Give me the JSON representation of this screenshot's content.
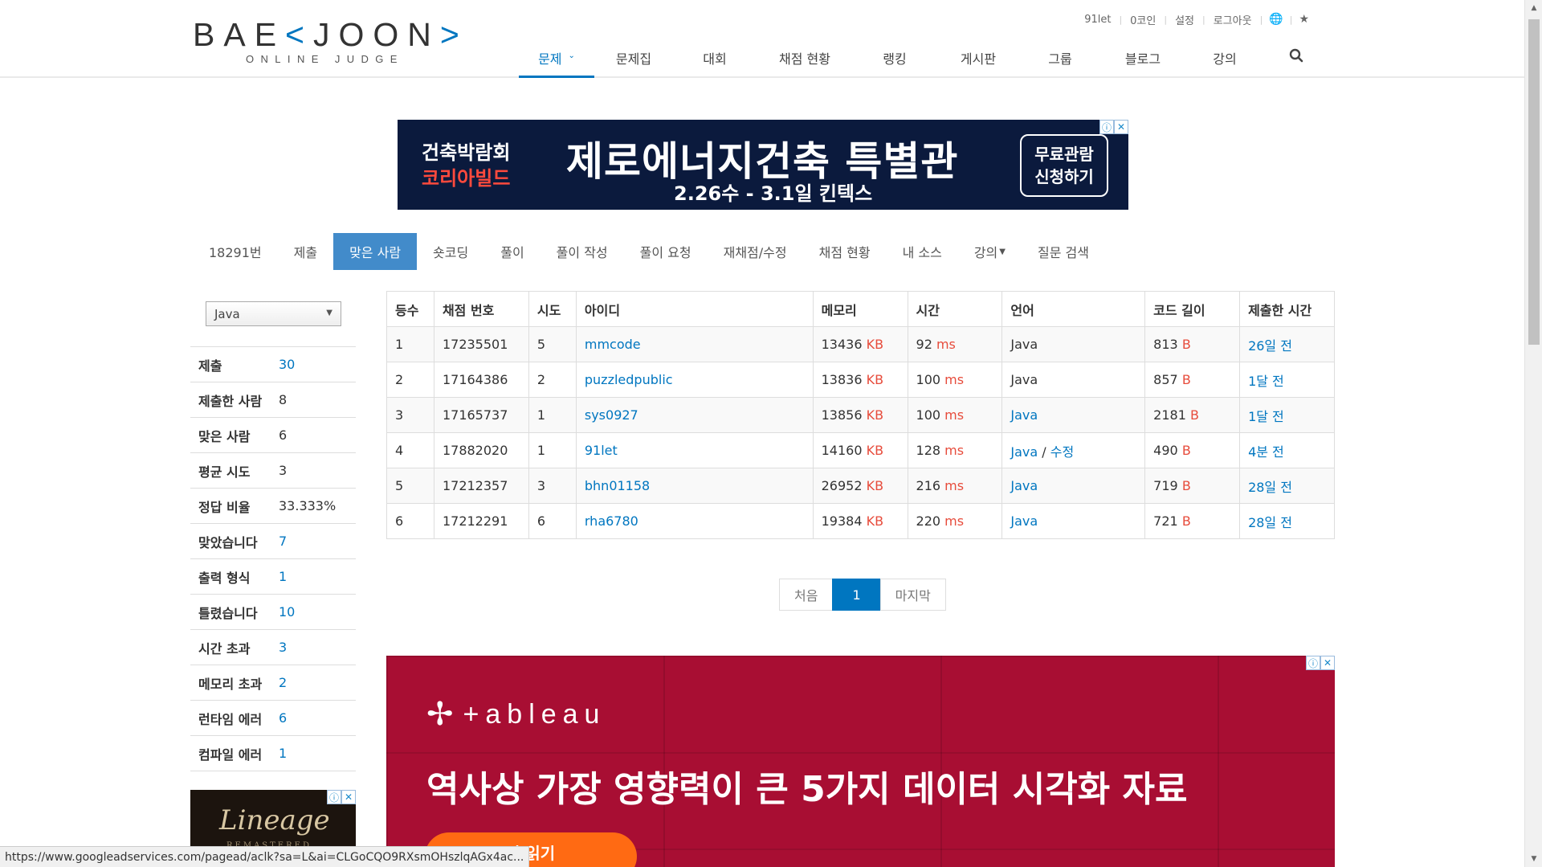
{
  "header": {
    "logo": {
      "main_prefix": "BAE",
      "main_accent": "<",
      "main_mid": "JOON",
      "main_accent2": ">",
      "sub": "ONLINE JUDGE"
    },
    "topbar": {
      "user": "91let",
      "coins": "0코인",
      "settings": "설정",
      "logout": "로그아웃",
      "globe_icon": "globe-icon",
      "star_icon": "star-icon"
    },
    "nav": [
      {
        "label": "문제",
        "active": true,
        "dropdown": true
      },
      {
        "label": "문제집"
      },
      {
        "label": "대회"
      },
      {
        "label": "채점 현황"
      },
      {
        "label": "랭킹"
      },
      {
        "label": "게시판"
      },
      {
        "label": "그룹"
      },
      {
        "label": "블로그"
      },
      {
        "label": "강의"
      }
    ],
    "search_icon": "search-icon"
  },
  "ad_top": {
    "left_line1": "건축박람회",
    "left_line2": "코리아빌드",
    "title": "제로에너지건축 특별관",
    "date": "2.26수 - 3.1일 킨텍스",
    "button_line1": "무료관람",
    "button_line2": "신청하기"
  },
  "subnav": [
    {
      "label": "18291번"
    },
    {
      "label": "제출"
    },
    {
      "label": "맞은 사람",
      "active": true
    },
    {
      "label": "숏코딩"
    },
    {
      "label": "풀이"
    },
    {
      "label": "풀이 작성"
    },
    {
      "label": "풀이 요청"
    },
    {
      "label": "재채점/수정"
    },
    {
      "label": "채점 현황"
    },
    {
      "label": "내 소스"
    },
    {
      "label": "강의",
      "dropdown": true
    },
    {
      "label": "질문 검색"
    }
  ],
  "language_filter": {
    "selected": "Java"
  },
  "stats": [
    {
      "label": "제출",
      "value": "30",
      "link": true
    },
    {
      "label": "제출한 사람",
      "value": "8",
      "link": false
    },
    {
      "label": "맞은 사람",
      "value": "6",
      "link": false
    },
    {
      "label": "평균 시도",
      "value": "3",
      "link": false
    },
    {
      "label": "정답 비율",
      "value": "33.333%",
      "link": false
    },
    {
      "label": "맞았습니다",
      "value": "7",
      "link": true
    },
    {
      "label": "출력 형식",
      "value": "1",
      "link": true
    },
    {
      "label": "틀렸습니다",
      "value": "10",
      "link": true
    },
    {
      "label": "시간 초과",
      "value": "3",
      "link": true
    },
    {
      "label": "메모리 초과",
      "value": "2",
      "link": true
    },
    {
      "label": "런타임 에러",
      "value": "6",
      "link": true
    },
    {
      "label": "컴파일 에러",
      "value": "1",
      "link": true
    }
  ],
  "table": {
    "columns": [
      "등수",
      "채점 번호",
      "시도",
      "아이디",
      "메모리",
      "시간",
      "언어",
      "코드 길이",
      "제출한 시간"
    ],
    "units": {
      "memory": "KB",
      "time": "ms",
      "length": "B"
    },
    "rows": [
      {
        "rank": "1",
        "submission": "17235501",
        "tries": "5",
        "user": "mmcode",
        "memory": "13436",
        "time": "92",
        "language": "Java",
        "lang_link": false,
        "edit": "",
        "length": "813",
        "submitted": "26일 전"
      },
      {
        "rank": "2",
        "submission": "17164386",
        "tries": "2",
        "user": "puzzledpublic",
        "memory": "13836",
        "time": "100",
        "language": "Java",
        "lang_link": false,
        "edit": "",
        "length": "857",
        "submitted": "1달 전"
      },
      {
        "rank": "3",
        "submission": "17165737",
        "tries": "1",
        "user": "sys0927",
        "memory": "13856",
        "time": "100",
        "language": "Java",
        "lang_link": true,
        "edit": "",
        "length": "2181",
        "submitted": "1달 전"
      },
      {
        "rank": "4",
        "submission": "17882020",
        "tries": "1",
        "user": "91let",
        "memory": "14160",
        "time": "128",
        "language": "Java",
        "lang_link": true,
        "edit": "수정",
        "length": "490",
        "submitted": "4분 전"
      },
      {
        "rank": "5",
        "submission": "17212357",
        "tries": "3",
        "user": "bhn01158",
        "memory": "26952",
        "time": "216",
        "language": "Java",
        "lang_link": true,
        "edit": "",
        "length": "719",
        "submitted": "28일 전"
      },
      {
        "rank": "6",
        "submission": "17212291",
        "tries": "6",
        "user": "rha6780",
        "memory": "19384",
        "time": "220",
        "language": "Java",
        "lang_link": true,
        "edit": "",
        "length": "721",
        "submitted": "28일 전"
      }
    ]
  },
  "pagination": {
    "first": "처음",
    "current": "1",
    "last": "마지막"
  },
  "ad_bottom": {
    "brand": "+ableau",
    "headline": "역사상 가장 영향력이 큰 5가지 데이터 시각화 자료",
    "cta": "서 읽기"
  },
  "ad_side": {
    "title": "Lineage",
    "sub": "REMASTERED"
  },
  "statusbar": {
    "url": "https://www.googleadservices.com/pagead/aclk?sa=L&ai=CLGoCQO9RXsmOHszlqAGx4ac..."
  },
  "colors": {
    "accent": "#0076c0",
    "active_tab": "#428bca",
    "unit_red": "#e74c3c",
    "ad_bottom_bg": "#a80e33",
    "ad_top_bg": "#0b1a3d",
    "cta_orange": "#ff6a13"
  }
}
